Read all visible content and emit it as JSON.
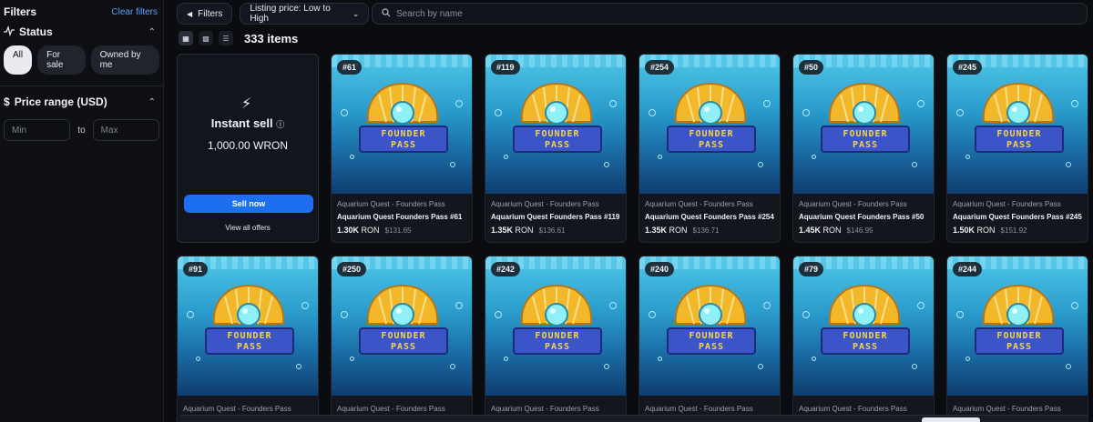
{
  "sidebar": {
    "title": "Filters",
    "clear_label": "Clear filters",
    "status": {
      "title": "Status",
      "pills": [
        "All",
        "For sale",
        "Owned by me"
      ],
      "active": "All"
    },
    "price": {
      "title": "Price range (USD)",
      "min_placeholder": "Min",
      "to_label": "to",
      "max_placeholder": "Max"
    }
  },
  "toolbar": {
    "filters_label": "Filters",
    "sort_label": "Listing price: Low to High",
    "search_placeholder": "Search by name",
    "items_count": "333 items"
  },
  "instant_sell": {
    "title": "Instant sell",
    "amount": "1,000.00 WRON",
    "sell_label": "Sell now",
    "view_offers": "View all offers"
  },
  "cards_row1": [
    {
      "badge": "#61",
      "collection": "Aquarium Quest - Founders Pass",
      "name": "Aquarium Quest Founders Pass #61",
      "ron": "1.30K",
      "usd": "$131.65"
    },
    {
      "badge": "#119",
      "collection": "Aquarium Quest - Founders Pass",
      "name": "Aquarium Quest Founders Pass #119",
      "ron": "1.35K",
      "usd": "$136.61"
    },
    {
      "badge": "#254",
      "collection": "Aquarium Quest - Founders Pass",
      "name": "Aquarium Quest Founders Pass #254",
      "ron": "1.35K",
      "usd": "$136.71"
    },
    {
      "badge": "#50",
      "collection": "Aquarium Quest - Founders Pass",
      "name": "Aquarium Quest Founders Pass #50",
      "ron": "1.45K",
      "usd": "$146.95"
    },
    {
      "badge": "#245",
      "collection": "Aquarium Quest - Founders Pass",
      "name": "Aquarium Quest Founders Pass #245",
      "ron": "1.50K",
      "usd": "$151.92"
    }
  ],
  "cards_row2": [
    {
      "badge": "#91",
      "collection": "Aquarium Quest - Founders Pass"
    },
    {
      "badge": "#250",
      "collection": "Aquarium Quest - Founders Pass"
    },
    {
      "badge": "#242",
      "collection": "Aquarium Quest - Founders Pass"
    },
    {
      "badge": "#240",
      "collection": "Aquarium Quest - Founders Pass"
    },
    {
      "badge": "#79",
      "collection": "Aquarium Quest - Founders Pass"
    },
    {
      "badge": "#244",
      "collection": "Aquarium Quest - Founders Pass"
    }
  ],
  "art": {
    "banner_line1": "FOUNDER",
    "banner_line2": "PASS"
  },
  "currency_unit": "RON",
  "colors": {
    "accent": "#1e6ef0",
    "link": "#5aa0ff",
    "background": "#0b0c10"
  }
}
